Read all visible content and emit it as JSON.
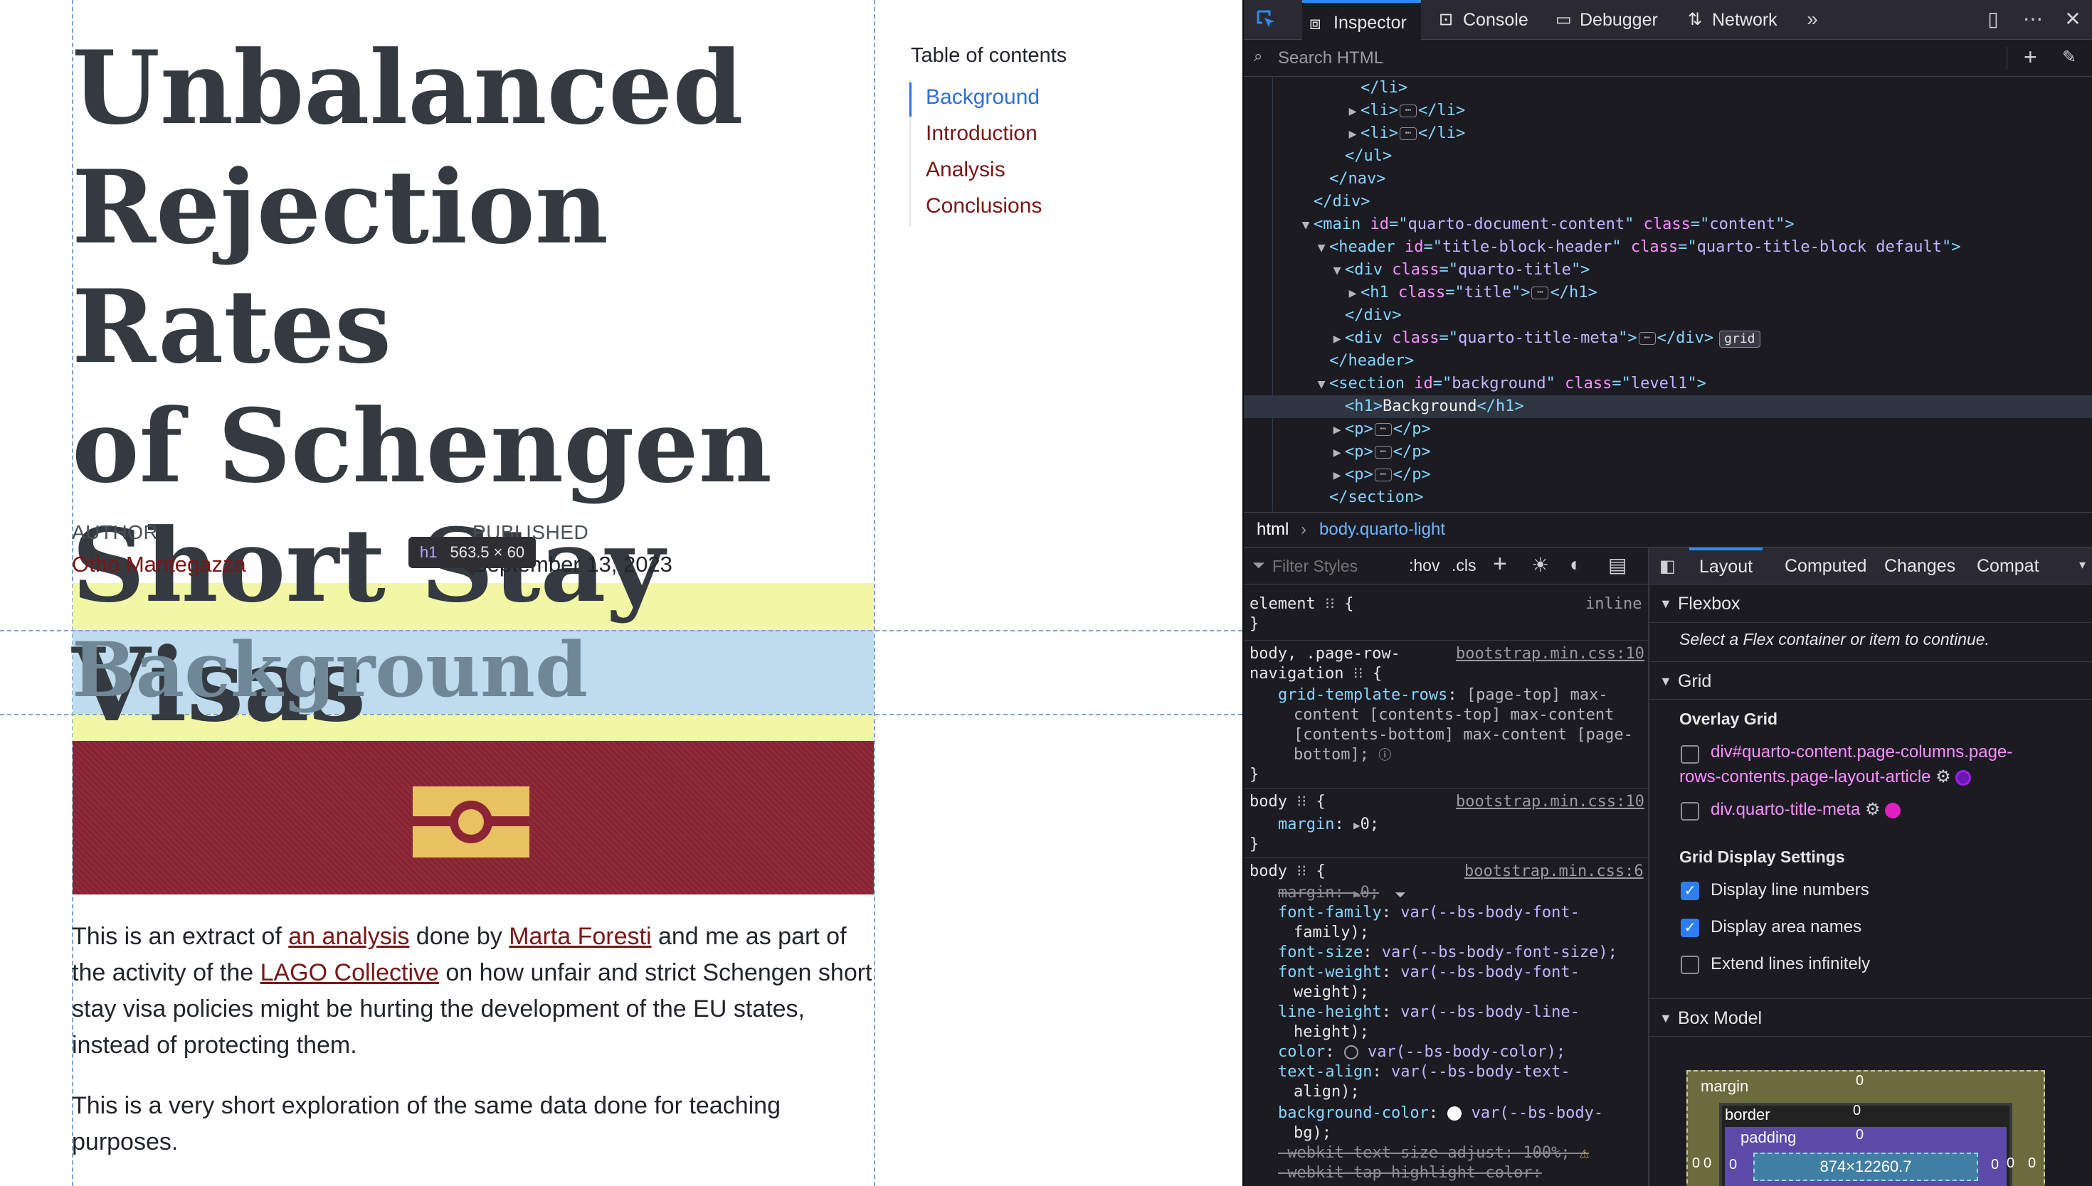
{
  "page": {
    "title_lines": [
      "Unbalanced",
      "Rejection Rates",
      "of Schengen",
      "Short Stay Visas"
    ],
    "author_label": "AUTHOR",
    "author_name": "Otho Mantegazza",
    "published_label": "PUBLISHED",
    "published_date": "September 13, 2023",
    "tooltip_tag": "h1",
    "tooltip_size": "563.5 × 60",
    "section_heading": "Background",
    "paragraph1": {
      "t1": "This is an extract of ",
      "link1": "an analysis",
      "t2": " done by ",
      "link2": "Marta Foresti",
      "t3": " and me as part of the activity of the ",
      "link3": "LAGO Collective",
      "t4": " on how unfair and strict Schengen short stay visa policies might be hurting the development of the EU states, instead of protecting them."
    },
    "paragraph2": "This is a very short exploration of the same data done for teaching purposes.",
    "toc": {
      "title": "Table of contents",
      "items": [
        "Background",
        "Introduction",
        "Analysis",
        "Conclusions"
      ],
      "active_index": 0
    }
  },
  "devtools": {
    "tabs": [
      "Inspector",
      "Console",
      "Debugger",
      "Network"
    ],
    "search_placeholder": "Search HTML",
    "markup": {
      "r0": "</li>",
      "r1a": "<li>",
      "r1b": "</li>",
      "r2a": "<li>",
      "r2b": "</li>",
      "r3": "</ul>",
      "r4": "</nav>",
      "r5": "</div>",
      "r6_tag": "main",
      "r6_id": "quarto-document-content",
      "r6_class": "content",
      "r7_tag": "header",
      "r7_id": "title-block-header",
      "r7_class": "quarto-title-block default",
      "r8_tag": "div",
      "r8_class": "quarto-title",
      "r9_tag": "h1",
      "r9_class": "title",
      "r10": "</div>",
      "r11_tag": "div",
      "r11_class": "quarto-title-meta",
      "r11_badge": "grid",
      "r12": "</header>",
      "r13_tag": "section",
      "r13_id": "background",
      "r13_class": "level1",
      "r14_text": "Background",
      "r15": "p",
      "r16": "p",
      "r17": "p",
      "r18": "</section>"
    },
    "breadcrumbs": [
      "html",
      "body.quarto-light"
    ],
    "rules": {
      "filter_placeholder": "Filter Styles",
      "hov": ":hov",
      "cls": ".cls",
      "element_selector": "element",
      "element_display": "inline",
      "rule1_selector_a": "body, .page-row-",
      "rule1_selector_b": "navigation",
      "rule1_source": "bootstrap.min.css:10",
      "rule1_prop": "grid-template-rows",
      "rule1_val_lines": [
        "[page-top] max-",
        "content [contents-top] max-content",
        "[contents-bottom] max-content [page-",
        "bottom];"
      ],
      "rule2_selector": "body",
      "rule2_source": "bootstrap.min.css:10",
      "rule2_prop": "margin",
      "rule2_val": "0;",
      "rule3_selector": "body",
      "rule3_source": "bootstrap.min.css:6",
      "rule3_margin": "margin: ",
      "rule3_margin_val": "0;",
      "decls": [
        {
          "p": "font-family",
          "v": "var(--bs-body-font-",
          "v2": "family);"
        },
        {
          "p": "font-size",
          "v": "var(--bs-body-font-size);",
          "v2": ""
        },
        {
          "p": "font-weight",
          "v": "var(--bs-body-font-",
          "v2": "weight);"
        },
        {
          "p": "line-height",
          "v": "var(--bs-body-line-",
          "v2": "height);"
        },
        {
          "p": "color",
          "v": "var(--bs-body-color);",
          "v2": ""
        },
        {
          "p": "text-align",
          "v": "var(--bs-body-text-",
          "v2": "align);"
        },
        {
          "p": "background-color",
          "v": "var(--bs-body-",
          "v2": "bg);"
        }
      ],
      "webkit1": "-webkit-text-size-adjust: 100%;",
      "webkit2": "-webkit-tap-highlight-color:"
    },
    "layout": {
      "tabs": [
        "Layout",
        "Computed",
        "Changes",
        "Compat"
      ],
      "flexbox_title": "Flexbox",
      "flexbox_hint": "Select a Flex container or item to continue.",
      "grid_title": "Grid",
      "overlay_grid": "Overlay Grid",
      "grid1_a": "div#quarto-content.page-columns.page-",
      "grid1_b": "rows-contents.page-layout-article",
      "grid2": "div.quarto-title-meta",
      "grid_display_settings": "Grid Display Settings",
      "display_line_numbers": "Display line numbers",
      "display_area_names": "Display area names",
      "extend_lines": "Extend lines infinitely",
      "box_model_title": "Box Model",
      "bm_margin": "margin",
      "bm_border": "border",
      "bm_padding": "padding",
      "bm_zero": "0",
      "bm_content": "874×12260.7"
    },
    "colors": {
      "accent": "#2d8cf0",
      "link_red": "#7a1616",
      "grid1_dot": "#a020f0",
      "grid2_dot": "#e020c0"
    }
  }
}
